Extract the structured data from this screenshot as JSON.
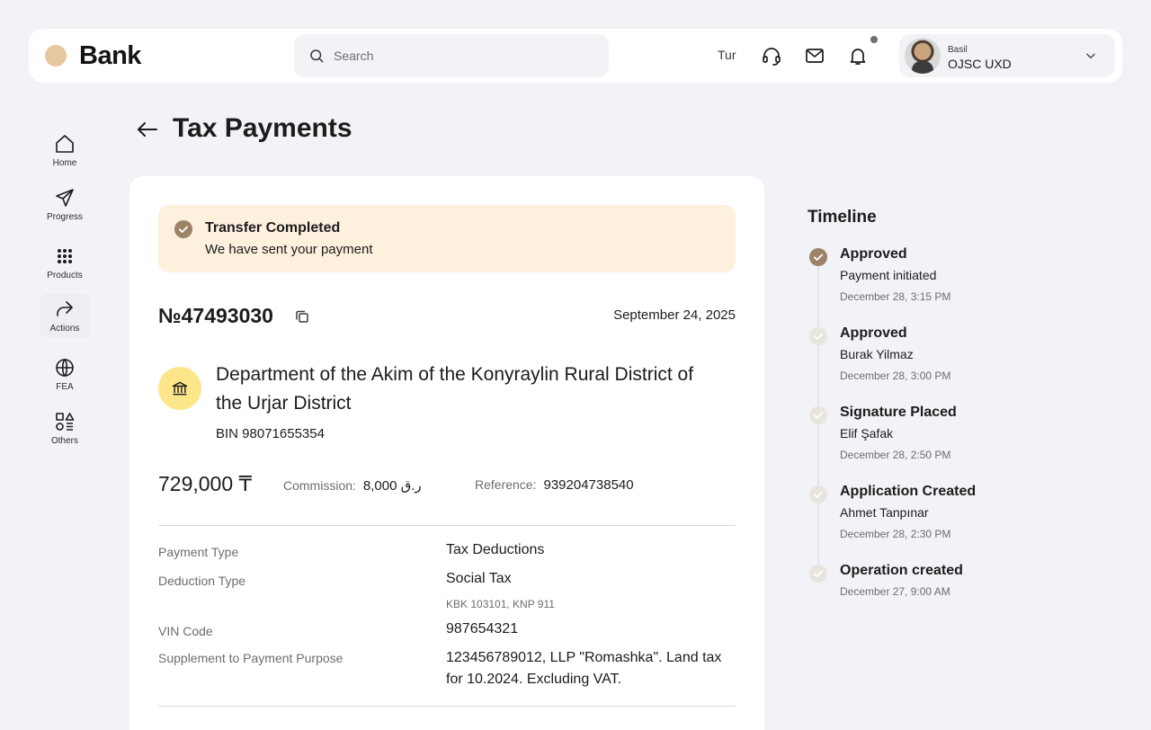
{
  "header": {
    "logo": "Bank",
    "search_placeholder": "Search",
    "lang": "Tur",
    "profile_small": "Basil",
    "profile_name": "OJSC UXD"
  },
  "sidebar": {
    "items": [
      {
        "label": "Home",
        "icon": "home-icon"
      },
      {
        "label": "Progress",
        "icon": "send-icon"
      },
      {
        "label": "Products",
        "icon": "grid-icon"
      },
      {
        "label": "Actions",
        "icon": "share-arrow-icon",
        "active": true
      },
      {
        "label": "FEA",
        "icon": "globe-icon"
      },
      {
        "label": "Others",
        "icon": "shapes-icon"
      }
    ]
  },
  "page": {
    "title": "Tax Payments"
  },
  "alert": {
    "title": "Transfer Completed",
    "text": "We have sent your payment"
  },
  "document": {
    "number": "№47493030",
    "date": "September 24, 2025",
    "org_name": "Department of the Akim of the Konyraylin Rural District of the Urjar District",
    "bin": "BIN 98071655354",
    "amount": "729,000 ₸",
    "commission_label": "Commission:",
    "commission_value": "ر.ق 8,000",
    "reference_label": "Reference:",
    "reference_value": "939204738540"
  },
  "details": {
    "payment_type_label": "Payment Type",
    "payment_type_value": "Tax Deductions",
    "deduction_type_label": "Deduction Type",
    "deduction_type_value": "Social Tax",
    "deduction_type_sub": "KBK 103101, KNP 911",
    "vin_label": "VIN Code",
    "vin_value": "987654321",
    "supplement_label": "Supplement to Payment Purpose",
    "supplement_value": "123456789012, LLP \"Romashka\". Land tax for 10.2024. Excluding VAT."
  },
  "timeline": {
    "title": "Timeline",
    "steps": [
      {
        "title": "Approved",
        "name": "Payment initiated",
        "date": "December 28, 3:15 PM",
        "status": "done"
      },
      {
        "title": "Approved",
        "name": "Burak Yilmaz",
        "date": "December 28, 3:00 PM",
        "status": "pending"
      },
      {
        "title": "Signature Placed",
        "name": "Elif Şafak",
        "date": "December 28, 2:50 PM",
        "status": "pending"
      },
      {
        "title": "Application Created",
        "name": "Ahmet Tanpınar",
        "date": "December 28, 2:30 PM",
        "status": "pending"
      },
      {
        "title": "Operation created",
        "name": "",
        "date": "December 27, 9:00 AM",
        "status": "pending"
      }
    ]
  },
  "colors": {
    "accent": "#9c8267",
    "alert_bg": "#fdf0dd",
    "org_icon_bg": "#fde68a",
    "logo_dot": "#e7c79e"
  }
}
